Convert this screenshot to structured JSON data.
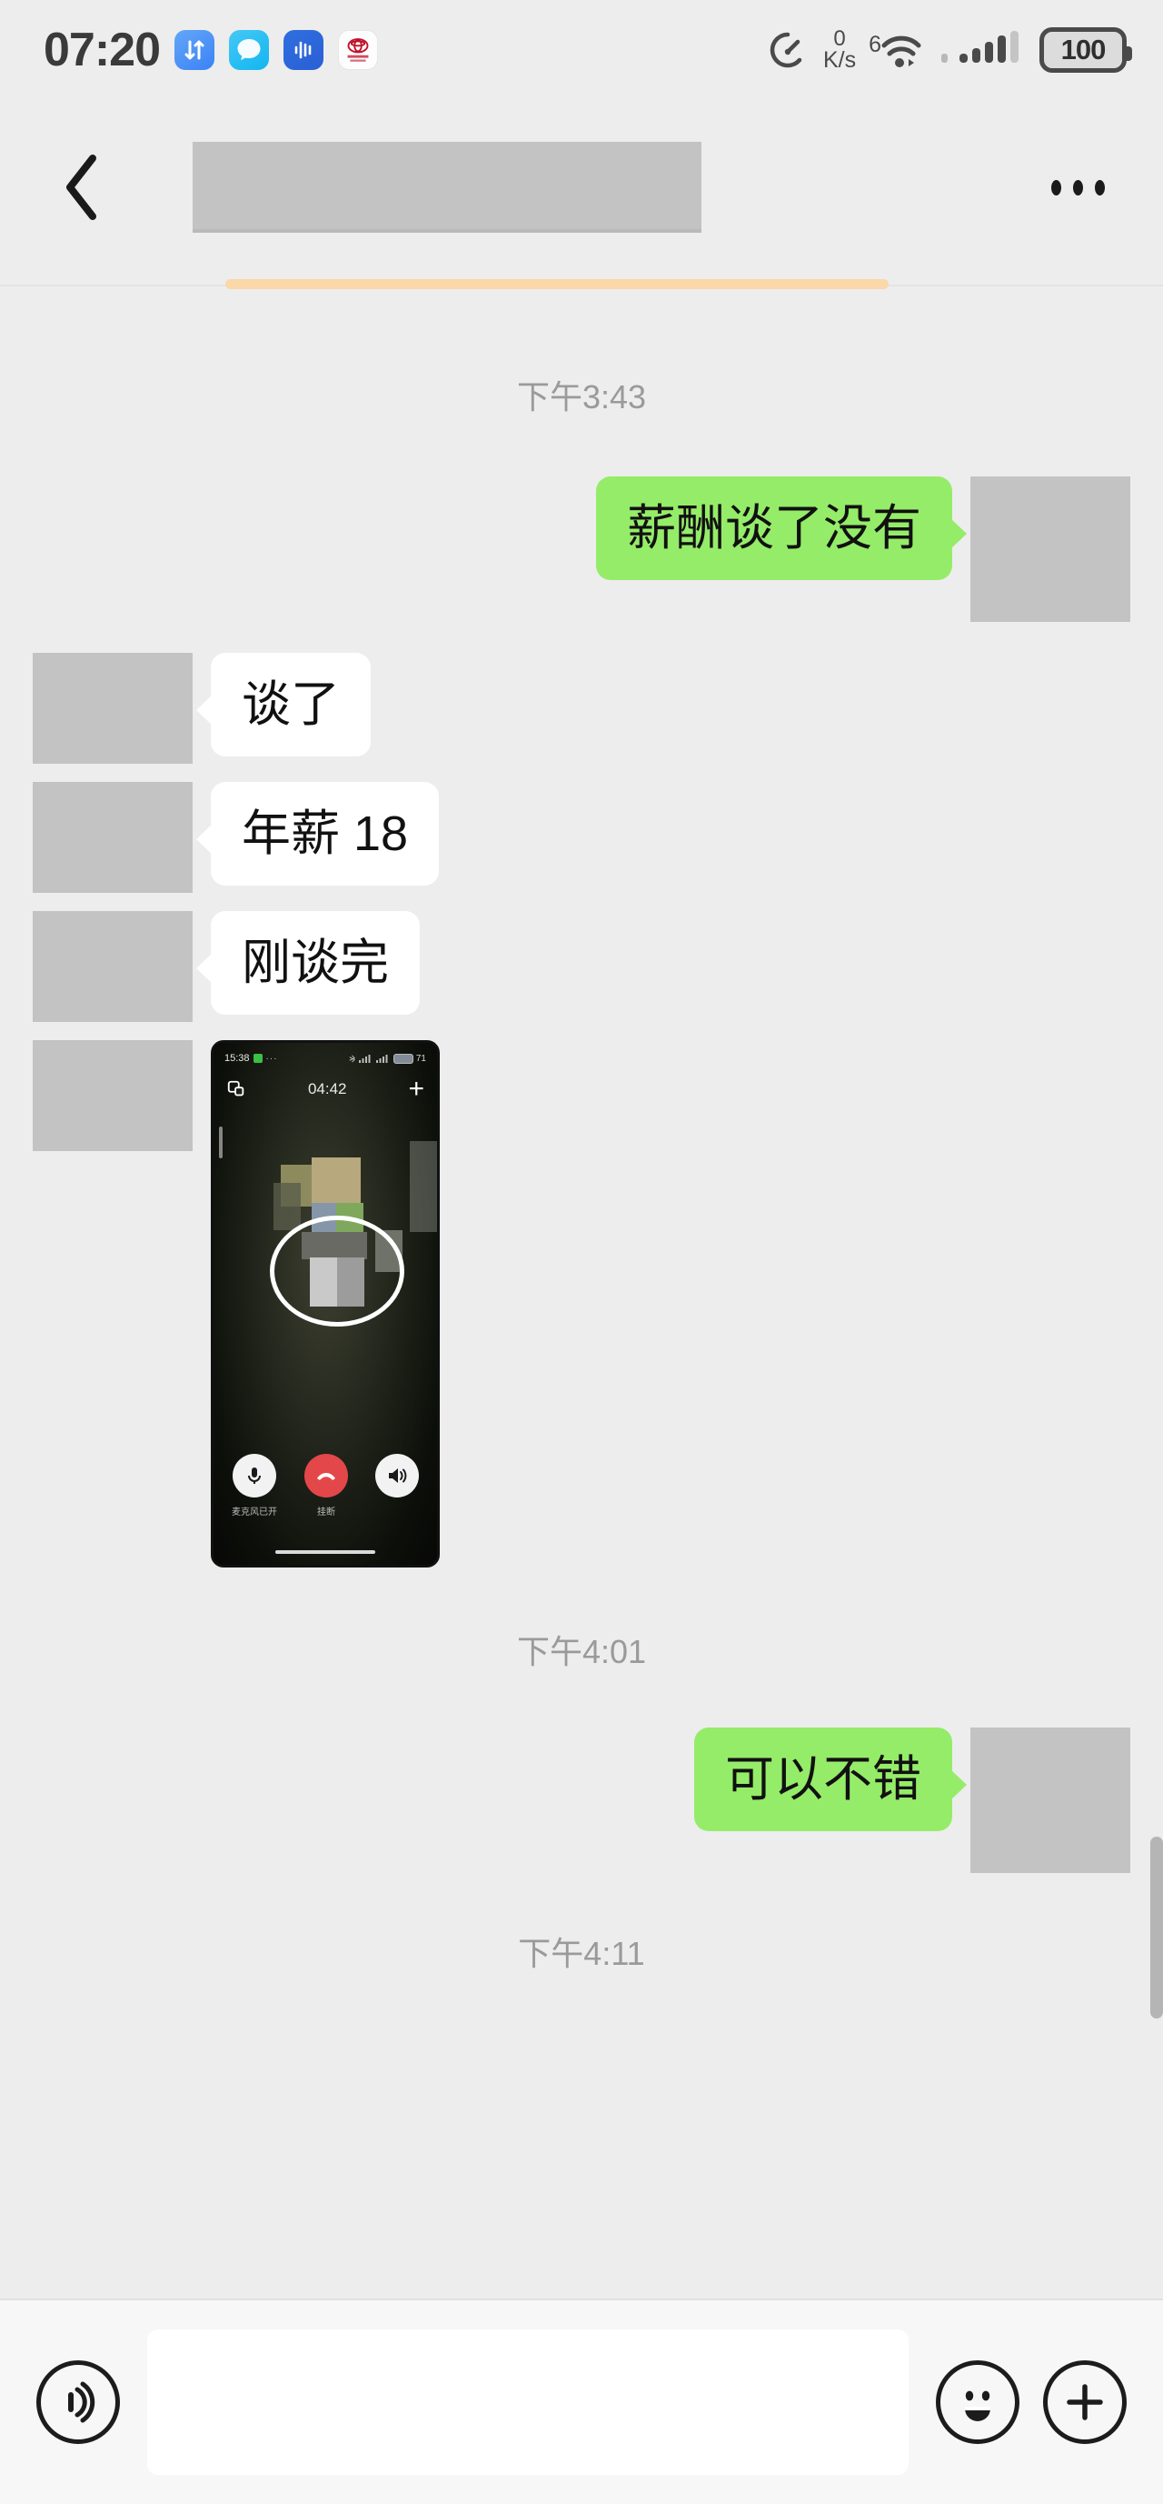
{
  "statusbar": {
    "time": "07:20",
    "network_speed_value": "0",
    "network_speed_unit": "K/s",
    "wifi_generation": "6",
    "battery_level": "100",
    "app_icons": [
      {
        "name": "file-transfer-icon",
        "label": "transfer"
      },
      {
        "name": "chat-bubble-icon",
        "label": "chat"
      },
      {
        "name": "voice-assistant-icon",
        "label": "voice"
      },
      {
        "name": "toyota-app-icon",
        "label": "toyota"
      }
    ]
  },
  "header": {
    "back_label": "back",
    "title_redacted": "",
    "more_label": "more options"
  },
  "chat": {
    "messages": [
      {
        "type": "timestamp",
        "text": "下午3:43"
      },
      {
        "type": "out_text",
        "text": "薪酬谈了没有"
      },
      {
        "type": "in_text",
        "text": "谈了"
      },
      {
        "type": "in_text",
        "text": "年薪 18"
      },
      {
        "type": "in_text",
        "text": "刚谈完"
      },
      {
        "type": "in_image",
        "text": ""
      },
      {
        "type": "timestamp",
        "text": "下午4:01"
      },
      {
        "type": "out_text",
        "text": "可以不错"
      },
      {
        "type": "timestamp",
        "text": "下午4:11"
      }
    ]
  },
  "video_call_image": {
    "status_time": "15:38",
    "status_dots": "···",
    "battery_level": "71",
    "call_duration": "04:42",
    "add_label": "+",
    "mic_label": "麦克风已开",
    "hangup_label": "挂断",
    "speaker_label": ""
  },
  "inputbar": {
    "voice_label": "voice input",
    "message_value": "",
    "message_placeholder": "",
    "emoji_label": "emoji",
    "more_label": "more"
  },
  "colors": {
    "page_bg": "#ededed",
    "out_bubble": "#95ec69",
    "in_bubble": "#ffffff",
    "redacted": "#c3c3c3",
    "timestamp_text": "#9a9a9a",
    "progress_accent": "#fbd7a5"
  }
}
